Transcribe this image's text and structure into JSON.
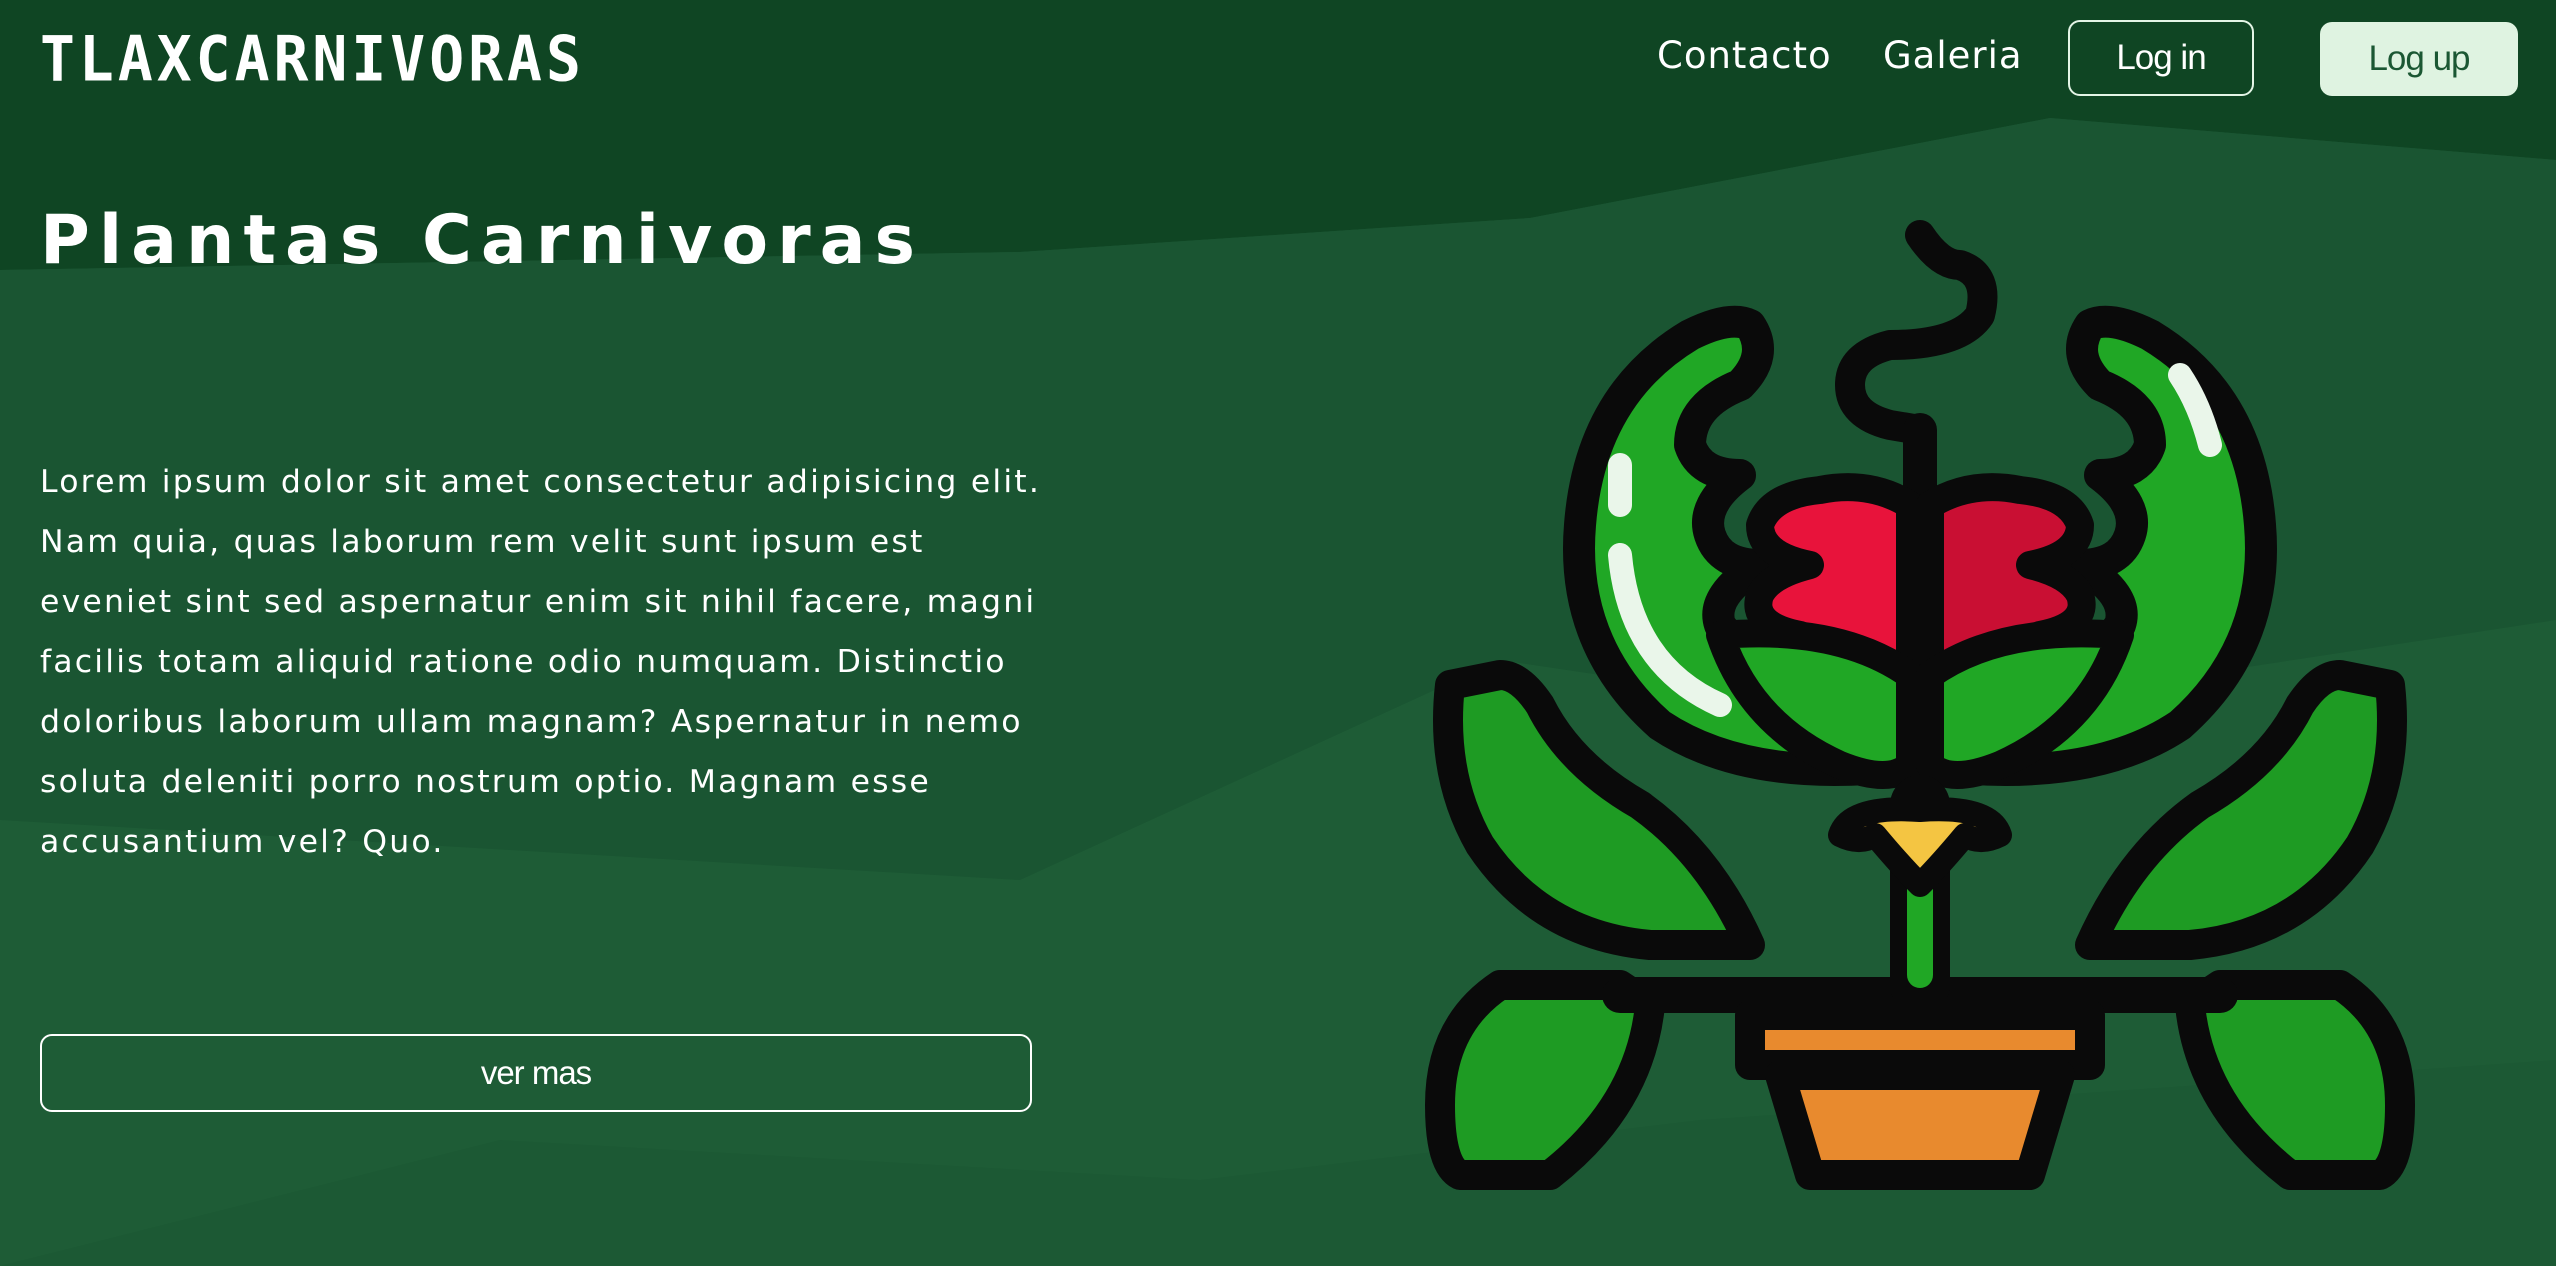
{
  "navbar": {
    "brand": "TLAXCARNIVORAS",
    "links": [
      {
        "label": "Contacto"
      },
      {
        "label": "Galeria"
      }
    ],
    "login_label": "Log in",
    "logup_label": "Log up"
  },
  "hero": {
    "title": "Plantas Carnivoras",
    "text": "Lorem ipsum dolor sit amet consectetur adipisicing elit. Nam quia, quas laborum rem velit sunt ipsum est eveniet sint sed aspernatur enim sit nihil facere, magni facilis totam aliquid ratione odio numquam. Distinctio doloribus laborum ullam magnam? Aspernatur in nemo soluta deleniti porro nostrum optio. Magnam esse accusantium vel? Quo.",
    "button_label": "ver mas"
  },
  "illustration": {
    "icon": "carnivorous-plant-icon"
  },
  "colors": {
    "background": "#1b5733",
    "background_dark": "#0f4523",
    "accent_light": "#dff3e1",
    "leaf_green": "#20a725",
    "flower_red": "#e8133b",
    "pot_orange": "#e88a2e",
    "bud_yellow": "#f4c542"
  }
}
